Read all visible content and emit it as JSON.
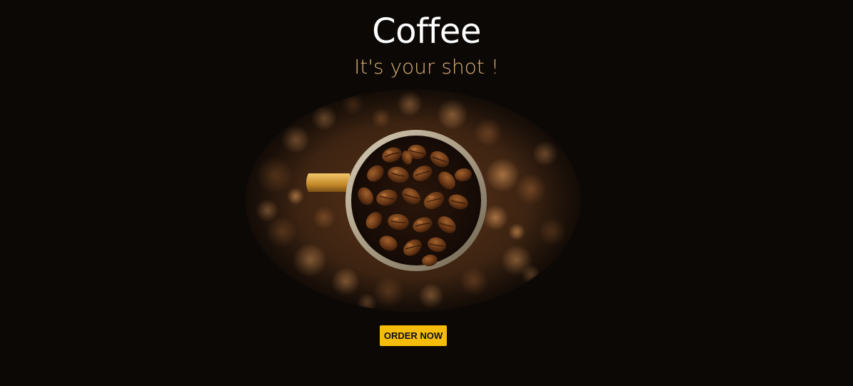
{
  "hero": {
    "title": "Coffee",
    "subtitle": "It's your shot !",
    "image_icon": "coffee-cup-beans-image"
  },
  "cta": {
    "label": "ORDER NOW"
  },
  "colors": {
    "background": "#0c0806",
    "title": "#ffffff",
    "subtitle": "#d9b074",
    "button": "#f5bc0a",
    "button_text": "#111111"
  }
}
